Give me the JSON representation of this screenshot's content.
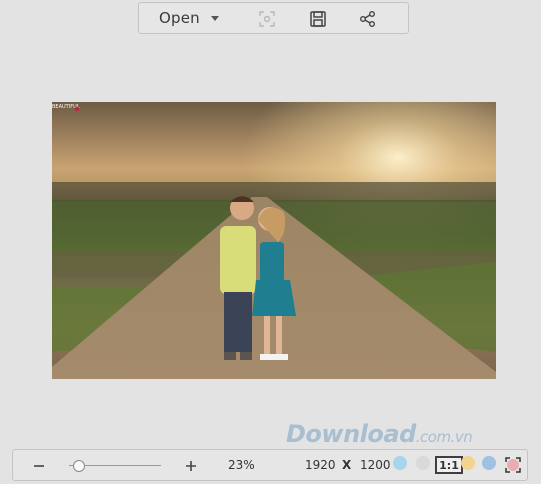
{
  "toolbar": {
    "open_label": "Open",
    "icons": [
      "chevron-down-icon",
      "crop-icon",
      "save-icon",
      "share-icon"
    ]
  },
  "image": {
    "description_icon": "photo",
    "watermark_text": "BEAUTIFUL"
  },
  "bottombar": {
    "zoom_percent": "23%",
    "zoom_slider_level": 0.1,
    "width": "1920",
    "x_label": "X",
    "height": "1200",
    "one_to_one_label": "1:1",
    "dot_colors": [
      "#a8d4ee",
      "#d9d9d9",
      "#f3d48f",
      "#9fc2e2",
      "#e9a0a8"
    ]
  },
  "brand": {
    "main": "Download",
    "sub": ".com.vn"
  }
}
